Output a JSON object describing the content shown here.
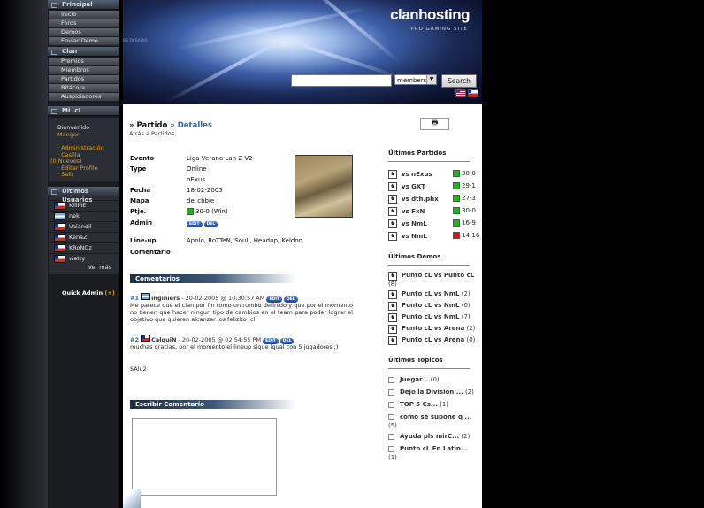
{
  "banner": {
    "logo": "clanhosting",
    "tagline": "PRO GAMING SITE",
    "credit": "RS DESIGNS",
    "search_placeholder": "",
    "search_scope": "members",
    "search_button": "Search"
  },
  "menu": {
    "principal_title": "Principal",
    "principal_items": [
      "Inicio",
      "Foros",
      "Demos",
      "Enviar Demo"
    ],
    "clan_title": "Clan",
    "clan_items": [
      "Premios",
      "Miembros",
      "Partidos",
      "Bitácora",
      "Auspiciadores"
    ],
    "mi_title": "Mi .cL",
    "welcome": "Bienvenido",
    "username": "Manger",
    "links": [
      "· Administración",
      "· Casilla",
      "(0 Nuevos)",
      "· Editar Profile",
      "· Salir"
    ],
    "users_title": "Últimos Usuarios",
    "users": [
      {
        "name": "KillME",
        "flag": "cl"
      },
      {
        "name": "nek",
        "flag": "ar"
      },
      {
        "name": "Valandil",
        "flag": "cl"
      },
      {
        "name": "KenaZ",
        "flag": "cl"
      },
      {
        "name": "KRoNOz",
        "flag": "cl"
      },
      {
        "name": "watty",
        "flag": "cl"
      }
    ],
    "ver_mas": "Ver más",
    "quick_admin": "Quick Admin",
    "quick_admin_plus": "(+)"
  },
  "match": {
    "crumb_part1": "» Partido",
    "crumb_part2": "» Detalles",
    "back": "Atrás a Partidos",
    "labels": {
      "evento": "Evento",
      "type": "Type",
      "fecha": "Fecha",
      "mapa": "Mapa",
      "ptje": "Ptje.",
      "admin": "Admin",
      "lineup": "Line-up",
      "comentario": "Comentario"
    },
    "evento": "Liga Verano Lan Z V2",
    "type": "Online",
    "opponent": "nExus",
    "fecha": "18-02-2005",
    "mapa": "de_cbble",
    "ptje": "30-0 (Win)",
    "edit": "EDIT",
    "del": "DEL",
    "lineup": "Apolo, RoTTeN, SouL, Headup, Keldon"
  },
  "comments": {
    "title": "Comentarios",
    "items": [
      {
        "num": "#1",
        "author": "inginiers",
        "date": "- 20-02-2005 @ 10:30:57 AM",
        "text": "Me parece que el clan por fin tomo un rumbo definido y que por el momento no tienen que hacer ningun tipo de cambios en el team para poder lograr el objetivo que quieren alcanzar los felizito .cl"
      },
      {
        "num": "#2",
        "author": "CalquiN",
        "date": "- 20-02-2005 @ 02:54:55 PM",
        "text": "muchas gracias, por el momento el lineup sigue igual con 5 jugadores ;)",
        "text2": "SAlu2"
      }
    ],
    "write_title": "Escribir Comentario"
  },
  "sidebar": {
    "partidos_title": "Últimos Partidos",
    "partidos": [
      {
        "opp": "vs nExus",
        "score": "30-0",
        "status": "green"
      },
      {
        "opp": "vs GXT",
        "score": "29-1",
        "status": "green"
      },
      {
        "opp": "vs dth.phx",
        "score": "27-3",
        "status": "green"
      },
      {
        "opp": "vs FxN",
        "score": "30-0",
        "status": "green"
      },
      {
        "opp": "vs NmL",
        "score": "16-9",
        "status": "green"
      },
      {
        "opp": "vs NmL",
        "score": "14-16",
        "status": "red"
      }
    ],
    "demos_title": "Últimos Demos",
    "demos": [
      {
        "title": "Punto cL vs Punto cL",
        "count": "(8)"
      },
      {
        "title": "Punto cL vs NmL",
        "count": "(2)"
      },
      {
        "title": "Punto cL vs NmL",
        "count": "(0)"
      },
      {
        "title": "Punto cL vs NmL",
        "count": "(7)"
      },
      {
        "title": "Punto cL vs Arena",
        "count": "(2)"
      },
      {
        "title": "Punto cL vs Arena",
        "count": "(0)"
      }
    ],
    "topicos_title": "Últimos Topicos",
    "topicos": [
      {
        "title": "Juegar...",
        "count": "(0)"
      },
      {
        "title": "Dejo la División ...",
        "count": "(2)"
      },
      {
        "title": "TOP 5 Cs...",
        "count": "(1)"
      },
      {
        "title": "como se supone q ...",
        "count": "(5)"
      },
      {
        "title": "Ayuda pls mirC...",
        "count": "(2)"
      },
      {
        "title": "Punto cL En Latin...",
        "count": "(1)"
      }
    ]
  }
}
